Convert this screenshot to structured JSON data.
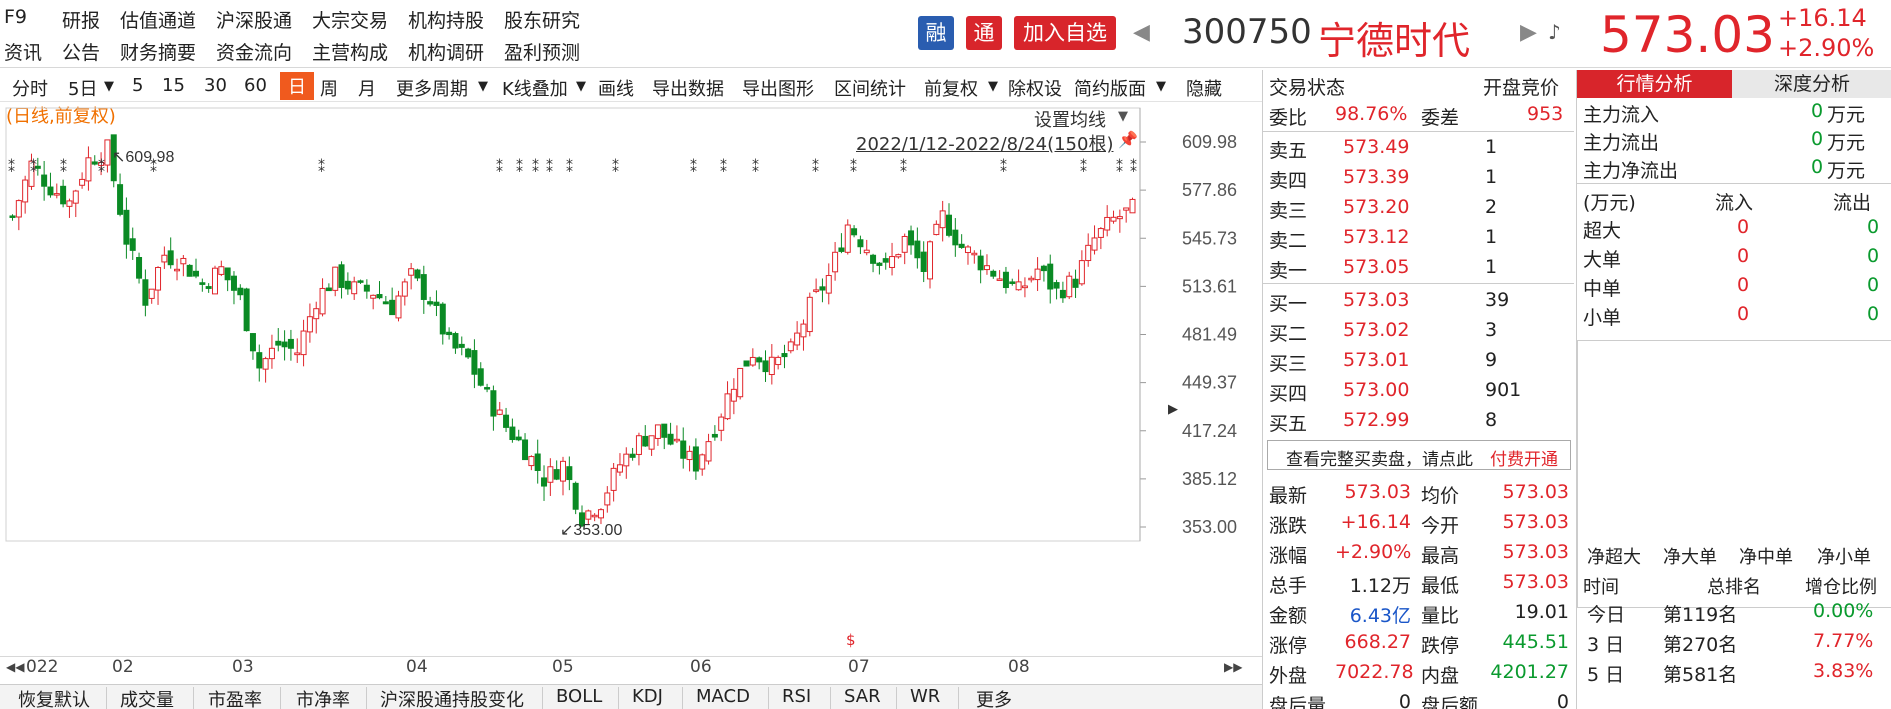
{
  "nav": {
    "f9": "F9",
    "row1": [
      "研报",
      "估值通道",
      "沪深股通",
      "大宗交易",
      "机构持股",
      "股东研究"
    ],
    "row2": [
      "资讯",
      "公告",
      "财务摘要",
      "资金流向",
      "主营构成",
      "机构调研",
      "盈利预测"
    ]
  },
  "header": {
    "rong": "融",
    "tong": "通",
    "add_watch": "加入自选",
    "code": "300750",
    "name": "宁德时代",
    "price": "573.03",
    "change": "+16.14",
    "change_pct": "+2.90%"
  },
  "toolbar": {
    "items": [
      "分时",
      "5日",
      "5",
      "15",
      "30",
      "60",
      "日",
      "周",
      "月",
      "更多周期",
      "K线叠加",
      "画线",
      "导出数据",
      "导出图形",
      "区间统计",
      "前复权",
      "除权设",
      "简约版面",
      "隐藏"
    ],
    "active": "日"
  },
  "chart": {
    "mode_label": "(日线,前复权)",
    "ma_setting": "设置均线",
    "range_label": "2022/1/12-2022/8/24(150根)",
    "high_label": "609.98",
    "low_label": "353.00",
    "y_ticks": [
      "609.98",
      "577.86",
      "545.73",
      "513.61",
      "481.49",
      "449.37",
      "417.24",
      "385.12",
      "353.00"
    ],
    "x_labels": [
      "022",
      "02",
      "03",
      "04",
      "05",
      "06",
      "07",
      "08"
    ],
    "colors": {
      "up": "#e0252b",
      "down": "#0a8a24"
    }
  },
  "chart_data": {
    "type": "candlestick",
    "title": "300750 宁德时代 (日线,前复权)",
    "range": "2022/1/12-2022/8/24",
    "bars": 150,
    "ylim": [
      353.0,
      609.98
    ],
    "y_ticks": [
      609.98,
      577.86,
      545.73,
      513.61,
      481.49,
      449.37,
      417.24,
      385.12,
      353.0
    ],
    "x_labels": [
      "2022",
      "02",
      "03",
      "04",
      "05",
      "06",
      "07",
      "08"
    ],
    "marked_high": 609.98,
    "marked_low": 353.0,
    "close_path": [
      [
        0,
        560
      ],
      [
        3,
        595
      ],
      [
        6,
        580
      ],
      [
        9,
        570
      ],
      [
        12,
        598
      ],
      [
        15,
        605
      ],
      [
        18,
        545
      ],
      [
        21,
        505
      ],
      [
        24,
        535
      ],
      [
        27,
        530
      ],
      [
        30,
        515
      ],
      [
        33,
        525
      ],
      [
        36,
        505
      ],
      [
        39,
        460
      ],
      [
        42,
        475
      ],
      [
        45,
        470
      ],
      [
        48,
        505
      ],
      [
        51,
        520
      ],
      [
        54,
        512
      ],
      [
        57,
        510
      ],
      [
        60,
        500
      ],
      [
        63,
        520
      ],
      [
        66,
        505
      ],
      [
        69,
        475
      ],
      [
        72,
        465
      ],
      [
        75,
        440
      ],
      [
        78,
        420
      ],
      [
        81,
        405
      ],
      [
        84,
        385
      ],
      [
        87,
        395
      ],
      [
        90,
        360
      ],
      [
        93,
        370
      ],
      [
        96,
        395
      ],
      [
        99,
        410
      ],
      [
        102,
        418
      ],
      [
        105,
        405
      ],
      [
        108,
        395
      ],
      [
        111,
        420
      ],
      [
        114,
        450
      ],
      [
        117,
        470
      ],
      [
        120,
        460
      ],
      [
        123,
        470
      ],
      [
        126,
        500
      ],
      [
        129,
        520
      ],
      [
        132,
        555
      ],
      [
        135,
        540
      ],
      [
        138,
        525
      ],
      [
        141,
        545
      ],
      [
        144,
        525
      ],
      [
        147,
        560
      ],
      [
        150,
        540
      ],
      [
        153,
        530
      ],
      [
        156,
        520
      ],
      [
        159,
        510
      ],
      [
        162,
        525
      ],
      [
        165,
        510
      ],
      [
        168,
        518
      ],
      [
        171,
        545
      ],
      [
        174,
        558
      ],
      [
        177,
        565
      ]
    ],
    "series_note": "approximate close trajectory (bar index, price)"
  },
  "orderbook": {
    "header": {
      "label": "交易状态",
      "right": "开盘竞价"
    },
    "weibi": {
      "label": "委比",
      "value": "98.76%",
      "label2": "委差",
      "value2": "953"
    },
    "sells": [
      {
        "label": "卖五",
        "price": "573.49",
        "vol": "1"
      },
      {
        "label": "卖四",
        "price": "573.39",
        "vol": "1"
      },
      {
        "label": "卖三",
        "price": "573.20",
        "vol": "2"
      },
      {
        "label": "卖二",
        "price": "573.12",
        "vol": "1"
      },
      {
        "label": "卖一",
        "price": "573.05",
        "vol": "1"
      }
    ],
    "buys": [
      {
        "label": "买一",
        "price": "573.03",
        "vol": "39"
      },
      {
        "label": "买二",
        "price": "573.02",
        "vol": "3"
      },
      {
        "label": "买三",
        "price": "573.01",
        "vol": "9"
      },
      {
        "label": "买四",
        "price": "573.00",
        "vol": "901"
      },
      {
        "label": "买五",
        "price": "572.99",
        "vol": "8"
      }
    ],
    "promo": {
      "text": "查看完整买卖盘，请点此",
      "link": "付费开通"
    },
    "stats": [
      {
        "l1": "最新",
        "v1": "573.03",
        "c1": "red",
        "l2": "均价",
        "v2": "573.03",
        "c2": "red"
      },
      {
        "l1": "涨跌",
        "v1": "+16.14",
        "c1": "red",
        "l2": "今开",
        "v2": "573.03",
        "c2": "red"
      },
      {
        "l1": "涨幅",
        "v1": "+2.90%",
        "c1": "red",
        "l2": "最高",
        "v2": "573.03",
        "c2": "red"
      },
      {
        "l1": "总手",
        "v1": "1.12万",
        "c1": "dark",
        "l2": "最低",
        "v2": "573.03",
        "c2": "red"
      },
      {
        "l1": "金额",
        "v1": "6.43亿",
        "c1": "blue",
        "l2": "量比",
        "v2": "19.01",
        "c2": "dark"
      },
      {
        "l1": "涨停",
        "v1": "668.27",
        "c1": "red",
        "l2": "跌停",
        "v2": "445.51",
        "c2": "green"
      },
      {
        "l1": "外盘",
        "v1": "7022.78",
        "c1": "red",
        "l2": "内盘",
        "v2": "4201.27",
        "c2": "green"
      },
      {
        "l1": "盘后量",
        "v1": "0",
        "c1": "dark",
        "l2": "盘后额",
        "v2": "0",
        "c2": "dark"
      }
    ]
  },
  "analysis": {
    "tabs": [
      "行情分析",
      "深度分析"
    ],
    "flows": [
      {
        "label": "主力流入",
        "value": "0",
        "unit": "万元"
      },
      {
        "label": "主力流出",
        "value": "0",
        "unit": "万元"
      },
      {
        "label": "主力净流出",
        "value": "0",
        "unit": "万元"
      }
    ],
    "table_header": [
      "(万元)",
      "流入",
      "流出"
    ],
    "table_rows": [
      {
        "label": "超大",
        "in": "0",
        "out": "0"
      },
      {
        "label": "大单",
        "in": "0",
        "out": "0"
      },
      {
        "label": "中单",
        "in": "0",
        "out": "0"
      },
      {
        "label": "小单",
        "in": "0",
        "out": "0"
      }
    ],
    "net_tabs": [
      "净超大",
      "净大单",
      "净中单",
      "净小单"
    ],
    "rank_header": [
      "时间",
      "总排名",
      "增仓比例"
    ],
    "rank_rows": [
      {
        "time": "今日",
        "rank": "第119名",
        "pct": "0.00%"
      },
      {
        "time": "3 日",
        "rank": "第270名",
        "pct": "7.77%"
      },
      {
        "time": "5 日",
        "rank": "第581名",
        "pct": "3.83%"
      }
    ]
  },
  "bottom_tabs": [
    "恢复默认",
    "成交量",
    "市盈率",
    "市净率",
    "沪深股通持股变化",
    "BOLL",
    "KDJ",
    "MACD",
    "RSI",
    "SAR",
    "WR",
    "更多"
  ]
}
